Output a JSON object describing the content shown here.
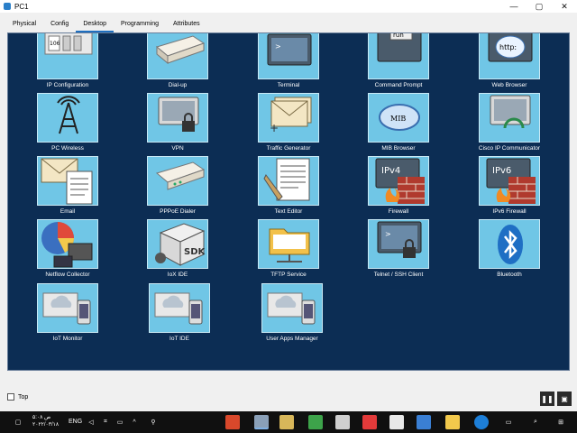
{
  "window": {
    "title": "PC1",
    "minimize_glyph": "—",
    "maximize_glyph": "▢",
    "close_glyph": "✕"
  },
  "tabs": [
    {
      "label": "Physical"
    },
    {
      "label": "Config"
    },
    {
      "label": "Desktop",
      "active": true
    },
    {
      "label": "Programming"
    },
    {
      "label": "Attributes"
    }
  ],
  "apps": [
    {
      "label": "IP Configuration",
      "icon": "ip-configuration-icon",
      "badge": "106"
    },
    {
      "label": "Dial-up",
      "icon": "modem-icon"
    },
    {
      "label": "Terminal",
      "icon": "terminal-icon",
      "glyph": ">"
    },
    {
      "label": "Command Prompt",
      "icon": "command-prompt-icon",
      "glyph": "run"
    },
    {
      "label": "Web Browser",
      "icon": "web-browser-icon",
      "glyph": "http:"
    },
    {
      "label": "PC Wireless",
      "icon": "wireless-tower-icon"
    },
    {
      "label": "VPN",
      "icon": "vpn-lock-icon"
    },
    {
      "label": "Traffic Generator",
      "icon": "envelopes-icon"
    },
    {
      "label": "MIB Browser",
      "icon": "mib-browser-icon",
      "glyph": "MIB"
    },
    {
      "label": "Cisco IP Communicator",
      "icon": "ip-communicator-icon"
    },
    {
      "label": "Email",
      "icon": "email-icon"
    },
    {
      "label": "PPPoE Dialer",
      "icon": "pppoe-modem-icon"
    },
    {
      "label": "Text Editor",
      "icon": "text-editor-icon"
    },
    {
      "label": "Firewall",
      "icon": "firewall-icon",
      "glyph": "IPv4"
    },
    {
      "label": "IPv6 Firewall",
      "icon": "ipv6-firewall-icon",
      "glyph": "IPv6"
    },
    {
      "label": "Netflow Collector",
      "icon": "netflow-icon"
    },
    {
      "label": "IoX IDE",
      "icon": "sdk-icon",
      "glyph": "SDK"
    },
    {
      "label": "TFTP Service",
      "icon": "folder-icon"
    },
    {
      "label": "Telnet / SSH Client",
      "icon": "telnet-lock-icon",
      "glyph": ">"
    },
    {
      "label": "Bluetooth",
      "icon": "bluetooth-icon"
    },
    {
      "label": "IoT Monitor",
      "icon": "iot-monitor-icon"
    },
    {
      "label": "IoT IDE",
      "icon": "iot-ide-icon"
    },
    {
      "label": "User Apps Manager",
      "icon": "user-apps-icon"
    }
  ],
  "bottom": {
    "top_label": "Top"
  },
  "taskbar": {
    "clock_time": "۵:۰۸ ص",
    "clock_date": "۲۰۲۲/۰۳/۱۸",
    "language": "ENG"
  },
  "colors": {
    "panel": "#0c2d54",
    "tile": "#70c6e6",
    "accent": "#1f6fbf"
  }
}
